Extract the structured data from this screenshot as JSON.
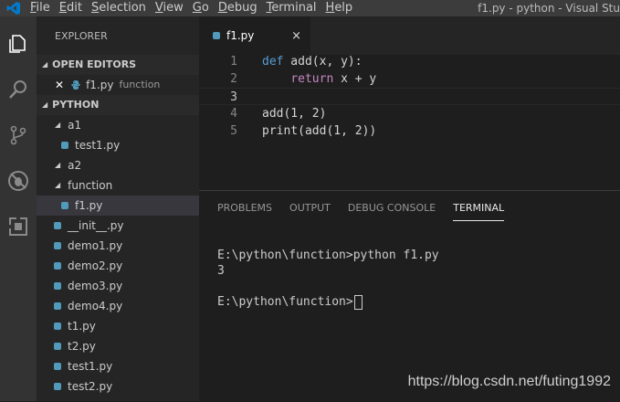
{
  "menu": [
    "File",
    "Edit",
    "Selection",
    "View",
    "Go",
    "Debug",
    "Terminal",
    "Help"
  ],
  "window_title": "f1.py - python - Visual Stu",
  "explorer": {
    "title": "EXPLORER",
    "open_editors_label": "OPEN EDITORS",
    "open_editor": {
      "name": "f1.py",
      "folder": "function"
    },
    "project_label": "PYTHON",
    "folder_a1": "a1",
    "file_a1_test1": "test1.py",
    "folder_a2": "a2",
    "folder_function": "function",
    "file_function_f1": "f1.py",
    "files": [
      "__init__.py",
      "demo1.py",
      "demo2.py",
      "demo3.py",
      "demo4.py",
      "t1.py",
      "t2.py",
      "test1.py",
      "test2.py"
    ]
  },
  "tab": {
    "label": "f1.py",
    "close": "×"
  },
  "code": {
    "line_numbers": [
      "1",
      "2",
      "3",
      "4",
      "5"
    ],
    "l1_kw": "def",
    "l1_rest": " add(x, y):",
    "l2_indent": "    ",
    "l2_kw": "return",
    "l2_rest": " x + y",
    "l4": "add(1, 2)",
    "l5": "print(add(1, 2))"
  },
  "panel": {
    "tabs": [
      "PROBLEMS",
      "OUTPUT",
      "DEBUG CONSOLE",
      "TERMINAL"
    ],
    "active_tab": "TERMINAL",
    "terminal_line1": "E:\\python\\function>python f1.py",
    "terminal_line2": "3",
    "terminal_prompt": "E:\\python\\function>"
  },
  "watermark": "https://blog.csdn.net/futing1992",
  "colors": {
    "accent": "#007acc",
    "python_icon": "#519aba",
    "keyword": "#569cd6",
    "control_keyword": "#c586c0"
  }
}
